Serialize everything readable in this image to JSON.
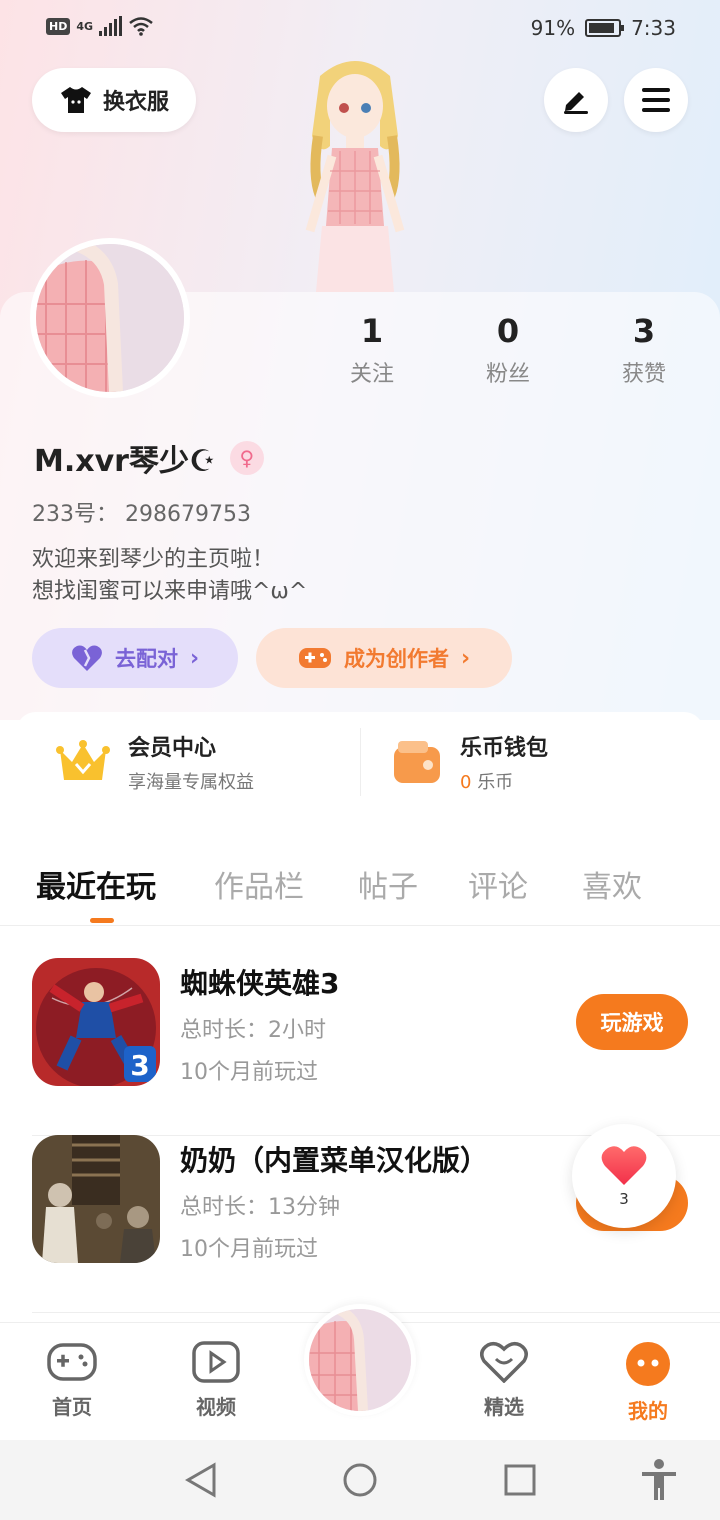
{
  "status_bar": {
    "network_badge": "HD",
    "network_type": "4G",
    "battery": "91%",
    "battery_level": 0.91,
    "time": "7:33"
  },
  "header": {
    "outfit_label": "换衣服",
    "icons": {
      "outfit": "tshirt-icon",
      "edit": "pen-icon",
      "menu": "menu-icon"
    }
  },
  "profile": {
    "stats": [
      {
        "num": "1",
        "label": "关注"
      },
      {
        "num": "0",
        "label": "粉丝"
      },
      {
        "num": "3",
        "label": "获赞"
      }
    ],
    "username": "M.xvr琴少☪",
    "gender_symbol": "♀",
    "uid_label": "233号：",
    "uid": "298679753",
    "bio_line1": "欢迎来到琴少的主页啦！",
    "bio_line2": "想找闺蜜可以来申请哦^ω^",
    "match_label": "去配对",
    "creator_label": "成为创作者"
  },
  "member": {
    "vip_title": "会员中心",
    "vip_sub": "享海量专属权益",
    "wallet_title": "乐币钱包",
    "wallet_amount": "0",
    "wallet_unit": "乐币"
  },
  "tabs": [
    "最近在玩",
    "作品栏",
    "帖子",
    "评论",
    "喜欢"
  ],
  "games": [
    {
      "name": "蜘蛛侠英雄3",
      "duration": "总时长：2小时",
      "last_played": "10个月前玩过",
      "button": "玩游戏"
    },
    {
      "name": "奶奶（内置菜单汉化版）",
      "duration": "总时长：13分钟",
      "last_played": "10个月前玩过",
      "button": ""
    }
  ],
  "like_bubble": {
    "count": "3"
  },
  "bottom_nav": [
    {
      "label": "首页",
      "icon": "gamepad-icon"
    },
    {
      "label": "视频",
      "icon": "play-icon"
    },
    {
      "label": "精选",
      "icon": "heart-chat-icon"
    },
    {
      "label": "我的",
      "icon": "smile-icon"
    }
  ],
  "colors": {
    "accent": "#f57a1e",
    "match": "#7a63d6"
  }
}
